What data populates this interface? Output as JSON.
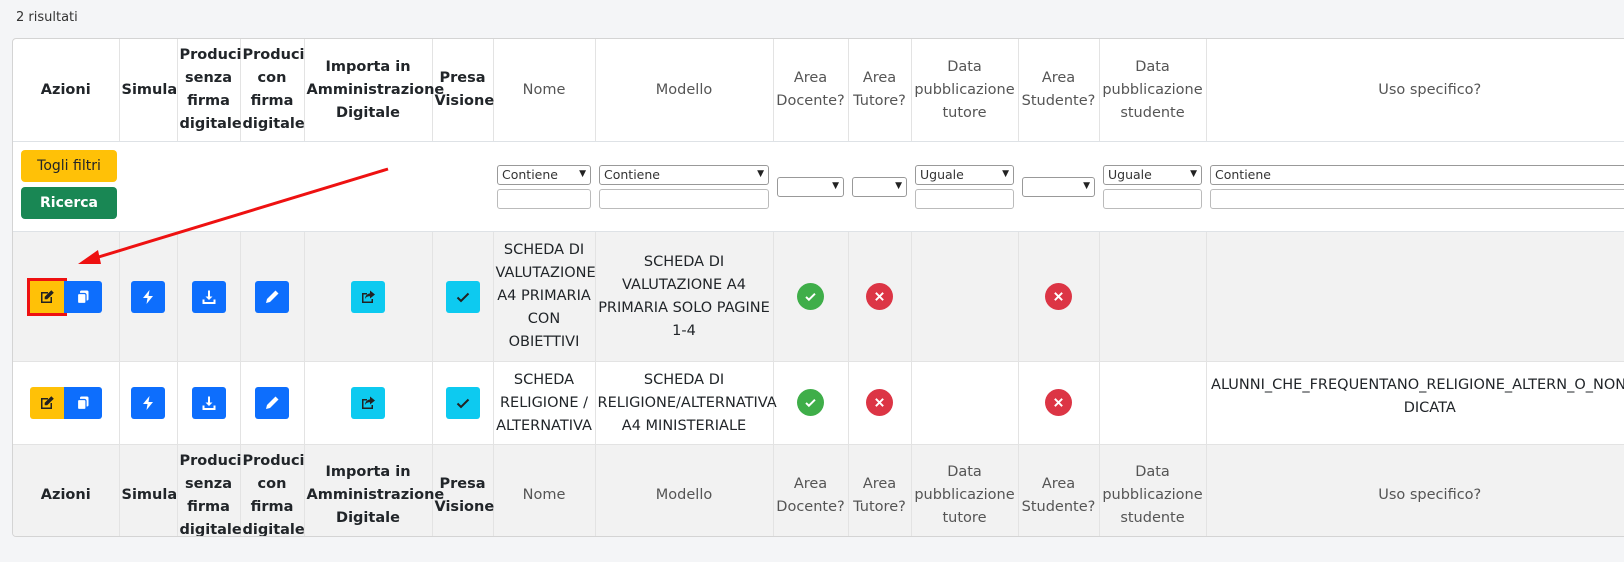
{
  "results_count": "2 risultati",
  "columns": {
    "azioni": "Azioni",
    "simula": "Simula",
    "produci_senza": "Produci senza firma digitale",
    "produci_con": "Produci con firma digitale",
    "importa": "Importa in Amministrazione Digitale",
    "presa_visione": "Presa Visione",
    "nome": "Nome",
    "modello": "Modello",
    "area_docente": "Area Docente?",
    "area_tutore": "Area Tutore?",
    "data_pub_tutore": "Data pubblicazione tutore",
    "area_studente": "Area Studente?",
    "data_pub_studente": "Data pubblicazione studente",
    "uso_specifico": "Uso specifico?"
  },
  "filters": {
    "togli_filtri": "Togli filtri",
    "ricerca": "Ricerca",
    "nome_op": "Contiene",
    "modello_op": "Contiene",
    "data_tutore_op": "Uguale",
    "data_studente_op": "Uguale",
    "uso_op": "Contiene"
  },
  "rows": [
    {
      "nome": "SCHEDA DI VALUTAZIONE A4 PRIMARIA CON OBIETTIVI",
      "modello": "SCHEDA DI VALUTAZIONE A4 PRIMARIA SOLO PAGINE 1-4",
      "area_docente": "yes",
      "area_tutore": "no",
      "data_pub_tutore": "",
      "area_studente": "no",
      "data_pub_studente": "",
      "uso_specifico": ""
    },
    {
      "nome": "SCHEDA RELIGIONE / ALTERNATIVA",
      "modello": "SCHEDA DI RELIGIONE/ALTERNATIVA A4 MINISTERIALE",
      "area_docente": "yes",
      "area_tutore": "no",
      "data_pub_tutore": "",
      "area_studente": "no",
      "data_pub_studente": "",
      "uso_specifico": "ALUNNI_CHE_FREQUENTANO_RELIGIONE_ALTERN_O_NON_INDICATA"
    }
  ],
  "colors": {
    "edit": "#ffc107",
    "primary": "#0d6efd",
    "info": "#0dcaf0",
    "success": "#3fae49",
    "danger": "#dc3545",
    "annotation": "#ee1111"
  },
  "icons": [
    "edit-icon",
    "copy-icon",
    "bolt-icon",
    "download-icon",
    "pencil-icon",
    "share-icon",
    "check-icon",
    "check-circle-icon",
    "x-circle-icon"
  ]
}
